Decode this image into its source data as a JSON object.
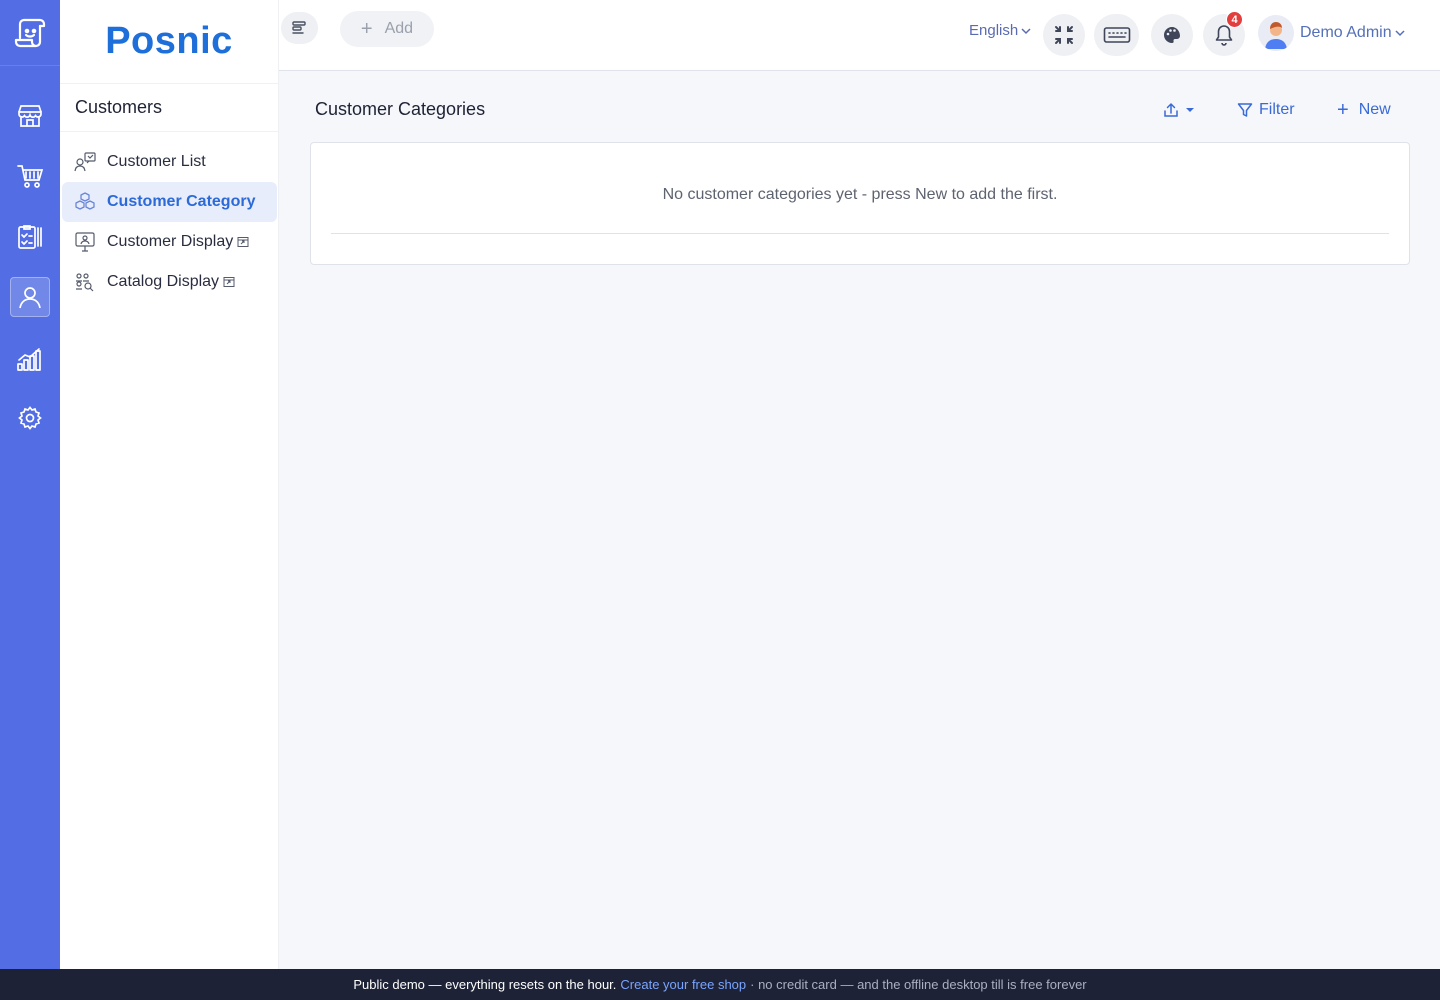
{
  "brand": {
    "name": "Posnic"
  },
  "rail": {
    "items": [
      {
        "icon": "store-icon"
      },
      {
        "icon": "cart-icon"
      },
      {
        "icon": "clipboard-icon"
      },
      {
        "icon": "user-icon",
        "active": true
      },
      {
        "icon": "chart-bars-icon"
      },
      {
        "icon": "gear-icon"
      }
    ]
  },
  "subnav": {
    "section_title": "Customers",
    "items": [
      {
        "label": "Customer List",
        "icon": "customer-list-icon"
      },
      {
        "label": "Customer Category",
        "icon": "cubes-icon",
        "active": true
      },
      {
        "label": "Customer Display",
        "icon": "monitor-icon",
        "external": true
      },
      {
        "label": "Catalog Display",
        "icon": "catalog-icon",
        "external": true
      }
    ]
  },
  "topbar": {
    "add_label": "Add",
    "language": "English",
    "notification_count": "4",
    "user_name": "Demo Admin"
  },
  "main": {
    "title": "Customer Categories",
    "filter_label": "Filter",
    "new_label": "New",
    "empty_message": "No customer categories yet - press New to add the first."
  },
  "footer": {
    "text_a": "Public demo — everything resets on the hour.",
    "link": "Create your free shop",
    "text_b": "· no credit card — and the offline desktop till is free forever"
  },
  "colors": {
    "rail": "#536ee4",
    "accent": "#1e6fd9",
    "link": "#3a6ad6",
    "footer": "#1d2237",
    "badge": "#e23e3e"
  }
}
